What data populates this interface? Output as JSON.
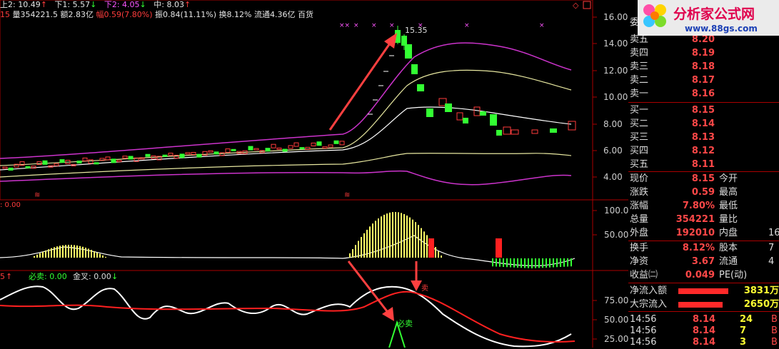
{
  "header": {
    "up2": "上2: 10.49",
    "down1": "下1: 5.57",
    "down2": "下2: 4.05",
    "mid": "中: 8.03",
    "vol": "量354221.5",
    "amount": "额2.83亿",
    "change": "幅0.59(7.80%)",
    "amplitude": "振0.84(11.11%)",
    "turnover": "换8.12%",
    "float": "流通4.36亿",
    "sector": "百货",
    "prefix": "15"
  },
  "price_axis": [
    "16.00",
    "14.00",
    "12.00",
    "10.00",
    "8.00",
    "6.00",
    "4.00"
  ],
  "peak_label": "15.35",
  "mid_panel": {
    "left_label": ": 0.00",
    "axis": [
      "100.0",
      "50.00"
    ]
  },
  "bottom_panel": {
    "prefix": "5",
    "sell_label": "必卖: 0.00",
    "cross_label": "金叉: 0.00",
    "axis": [
      "75.00",
      "50.00",
      "25.00"
    ],
    "signal": "必卖",
    "small_text": "卖"
  },
  "logo": {
    "title": "分析家公式网",
    "url": "www.88gs.com"
  },
  "order_book": {
    "partial_top": "委",
    "asks": [
      {
        "label": "卖五",
        "price": "8.20"
      },
      {
        "label": "卖四",
        "price": "8.19"
      },
      {
        "label": "卖三",
        "price": "8.18"
      },
      {
        "label": "卖二",
        "price": "8.17"
      },
      {
        "label": "卖一",
        "price": "8.16"
      }
    ],
    "bids": [
      {
        "label": "买一",
        "price": "8.15"
      },
      {
        "label": "买二",
        "price": "8.14"
      },
      {
        "label": "买三",
        "price": "8.13"
      },
      {
        "label": "买四",
        "price": "8.12"
      },
      {
        "label": "买五",
        "price": "8.11"
      }
    ]
  },
  "quote": [
    {
      "label": "现价",
      "value": "8.15",
      "label2": "今开",
      "value2": ""
    },
    {
      "label": "涨跌",
      "value": "0.59",
      "label2": "最高",
      "value2": ""
    },
    {
      "label": "涨幅",
      "value": "7.80%",
      "label2": "最低",
      "value2": ""
    },
    {
      "label": "总量",
      "value": "354221",
      "label2": "量比",
      "value2": ""
    },
    {
      "label": "外盘",
      "value": "192010",
      "label2": "内盘",
      "value2": "16"
    }
  ],
  "fund": [
    {
      "label": "换手",
      "value": "8.12%",
      "label2": "股本",
      "value2": "7"
    },
    {
      "label": "净资",
      "value": "3.67",
      "label2": "流通",
      "value2": "4"
    },
    {
      "label": "收益㈡",
      "value": "0.049",
      "label2": "PE(动)",
      "value2": ""
    }
  ],
  "flow": [
    {
      "label": "净流入额",
      "value": "3831万",
      "bar_pct": 70
    },
    {
      "label": "大宗流入",
      "value": "2650万",
      "bar_pct": 62
    }
  ],
  "ticks": [
    {
      "time": "14:56",
      "price": "8.14",
      "vol": "24",
      "flag": "B"
    },
    {
      "time": "14:56",
      "price": "8.14",
      "vol": "7",
      "flag": "B"
    },
    {
      "time": "14:56",
      "price": "8.14",
      "vol": "3",
      "flag": "B"
    }
  ],
  "colors": {
    "up": "#ff3c3c",
    "down": "#33ff33",
    "accent": "#ffff33",
    "band": "#cc33cc"
  }
}
